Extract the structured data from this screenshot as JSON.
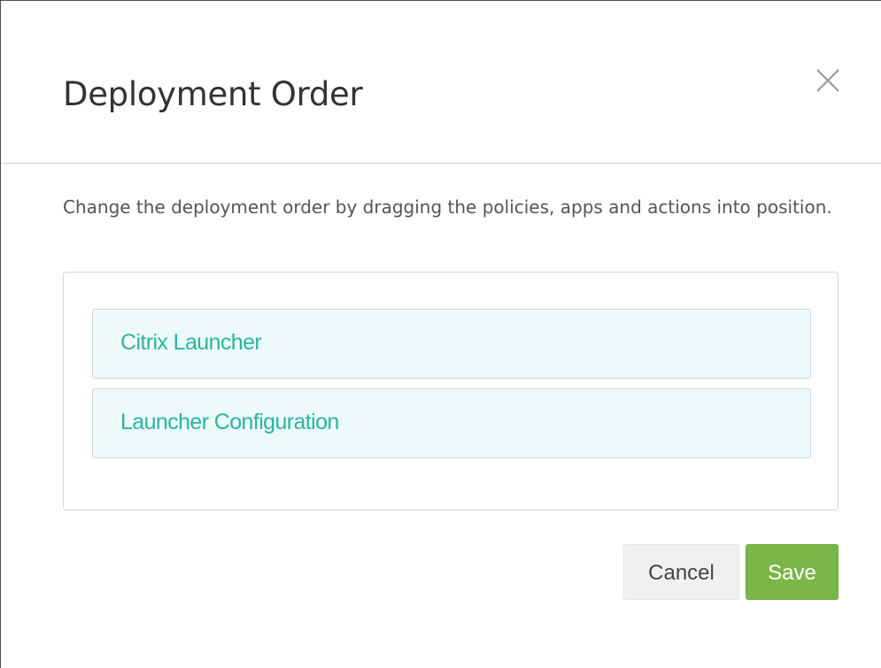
{
  "dialog": {
    "title": "Deployment Order",
    "close_icon": "close-icon",
    "instructions": "Change the deployment order by dragging the policies, apps and actions into position.",
    "items": [
      {
        "label": "Citrix Launcher"
      },
      {
        "label": "Launcher Configuration"
      }
    ],
    "buttons": {
      "cancel_label": "Cancel",
      "save_label": "Save"
    },
    "colors": {
      "item_text": "#2ab5a0",
      "item_bg": "#eefafa",
      "save_bg": "#7ab648",
      "cancel_bg": "#f0f0f0"
    }
  }
}
